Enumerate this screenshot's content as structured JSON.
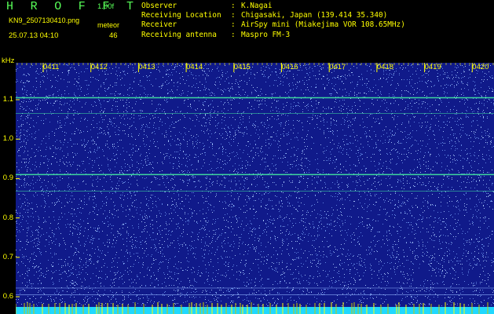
{
  "header": {
    "title": "H R O F F T",
    "version": "1.00f",
    "filename": "KN9_2507130410.png",
    "unit_label": "meteor",
    "datetime": "25.07.13 04:10",
    "count": "46"
  },
  "info": {
    "rows": [
      {
        "key": "Observer",
        "value": "K.Nagai"
      },
      {
        "key": "Receiving Location",
        "value": "Chigasaki, Japan (139.414 35.340)"
      },
      {
        "key": "Receiver",
        "value": "AirSpy mini (Miakejima VOR 108.65MHz)"
      },
      {
        "key": "Receiving antenna",
        "value": "Maspro FM-3"
      }
    ]
  },
  "colors": {
    "text": "#ffff00",
    "title": "#58ff58",
    "background": "#101a8a",
    "noise_speckle": "#7aa8ff",
    "tone_line": "#40e0a0",
    "bottom_band": "#20d8ff"
  },
  "chart_data": {
    "type": "heatmap",
    "y_unit": "kHz",
    "y_ticks": [
      "1.1",
      "1.0",
      "0.9",
      "0.8",
      "0.7",
      "0.6"
    ],
    "y_tick_values": [
      1.1,
      1.0,
      0.9,
      0.8,
      0.7,
      0.6
    ],
    "x_ticks": [
      "0411",
      "0412",
      "0413",
      "0414",
      "0415",
      "0416",
      "0417",
      "0418",
      "0419",
      "0420"
    ],
    "ylim": [
      0.58,
      1.2
    ],
    "horizontal_lines_khz": [
      1.105,
      1.065,
      0.91,
      0.868,
      0.622,
      0.605
    ],
    "grid": false
  }
}
